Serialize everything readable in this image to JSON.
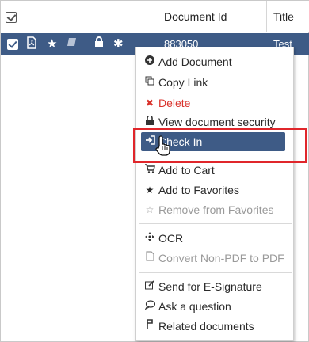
{
  "header": {
    "select_all": "checked",
    "col_document_id": "Document Id",
    "col_title": "Title"
  },
  "row": {
    "document_id": "883050",
    "title": "Test"
  },
  "menu": {
    "add_document": "Add Document",
    "copy_link": "Copy Link",
    "delete": "Delete",
    "view_security": "View document security",
    "check_in": "Check In",
    "add_to_cart": "Add to Cart",
    "add_to_favorites": "Add to Favorites",
    "remove_from_favorites": "Remove from Favorites",
    "ocr": "OCR",
    "convert_non_pdf": "Convert Non-PDF to PDF",
    "send_esignature": "Send for E-Signature",
    "ask_question": "Ask a question",
    "related_documents": "Related documents"
  },
  "colors": {
    "accent": "#3e5b86",
    "danger": "#d9322b",
    "highlight_box": "#e0262b"
  }
}
